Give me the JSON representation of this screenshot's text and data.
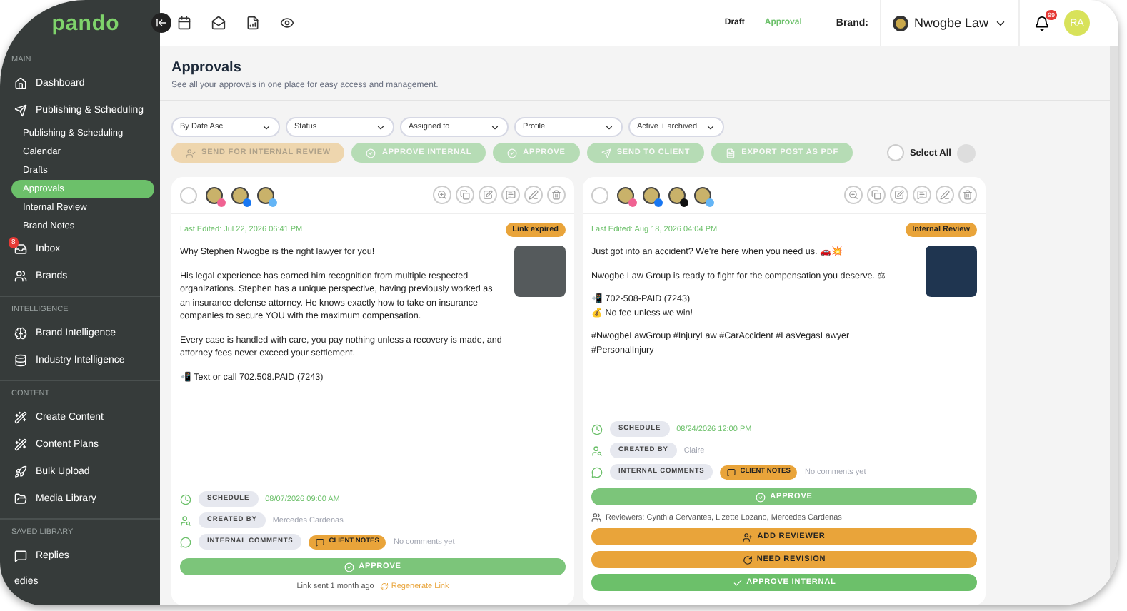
{
  "sidebar": {
    "logo": "pando",
    "sections": [
      {
        "heading": "MAIN",
        "items": [
          {
            "label": "Dashboard",
            "selected": false
          },
          {
            "label": "Publishing & Scheduling",
            "selected": false,
            "children": [
              {
                "label": "Publishing & Scheduling",
                "selected": false
              },
              {
                "label": "Calendar",
                "selected": false
              },
              {
                "label": "Drafts",
                "selected": false
              },
              {
                "label": "Approvals",
                "selected": true
              },
              {
                "label": "Internal Review",
                "selected": false
              },
              {
                "label": "Brand Notes",
                "selected": false
              }
            ]
          },
          {
            "label": "Inbox",
            "selected": false,
            "badge": "8"
          },
          {
            "label": "Brands",
            "selected": false
          }
        ]
      },
      {
        "heading": "INTELLIGENCE",
        "items": [
          {
            "label": "Brand Intelligence",
            "selected": false
          },
          {
            "label": "Industry Intelligence",
            "selected": false
          }
        ]
      },
      {
        "heading": "CONTENT",
        "items": [
          {
            "label": "Create Content",
            "selected": false
          },
          {
            "label": "Content Plans",
            "selected": false
          },
          {
            "label": "Bulk Upload",
            "selected": false
          },
          {
            "label": "Media Library",
            "selected": false
          }
        ]
      },
      {
        "heading": "SAVED LIBRARY",
        "items": [
          {
            "label": "Replies",
            "selected": false
          },
          {
            "label": "edies",
            "selected": false
          }
        ]
      }
    ]
  },
  "topbar": {
    "tabs": [
      {
        "label": "Draft",
        "selected": false
      },
      {
        "label": "Approval",
        "selected": true
      }
    ],
    "brand_label": "Brand:",
    "brand_name": "Nwogbe Law",
    "notifications": "99",
    "avatar": "RA"
  },
  "page": {
    "title": "Approvals",
    "subtitle": "See all your approvals in one place for easy access and management.",
    "filters": [
      {
        "label": "By Date Asc"
      },
      {
        "label": "Status"
      },
      {
        "label": "Assigned to"
      },
      {
        "label": "Profile"
      },
      {
        "label": "Active + archived"
      }
    ],
    "actions": [
      {
        "label": "SEND FOR INTERNAL REVIEW",
        "kind": "review",
        "disabled": true
      },
      {
        "label": "APPROVE INTERNAL",
        "kind": "approve",
        "disabled": true
      },
      {
        "label": "APPROVE",
        "kind": "approve",
        "disabled": true
      },
      {
        "label": "SEND TO CLIENT",
        "kind": "send",
        "disabled": true
      },
      {
        "label": "EXPORT POST AS PDF",
        "kind": "pdf",
        "disabled": true
      }
    ],
    "select_all": {
      "label": "Select All",
      "checked": false
    }
  },
  "cards": [
    {
      "checked": false,
      "platforms": [
        {
          "kind": "instagram"
        },
        {
          "kind": "facebook"
        },
        {
          "kind": "linkedin"
        }
      ],
      "last_edited": "Last Edited: Jul 22, 2026 06:41 PM",
      "status": "Link expired",
      "text": [
        "Why Stephen Nwogbe is the right lawyer for you!",
        "His legal experience has earned him recognition from multiple respected organizations. Stephen has a unique perspective, having previously worked as an insurance defense attorney. He knows exactly how to take on insurance companies to secure YOU with the maximum compensation.",
        "Every case is handled with care, you pay nothing unless a recovery is made, and attorney fees never exceed your settlement.",
        "📲 Text or call 702.508.PAID (7243)"
      ],
      "schedule_label": "SCHEDULE",
      "schedule": "08/07/2026 09:00 AM",
      "created_label": "CREATED BY",
      "created_by": "Mercedes Cardenas",
      "internal_label": "INTERNAL COMMENTS",
      "notes_label": "CLIENT NOTES",
      "comments": "No comments yet",
      "buttons": [
        {
          "label": "APPROVE",
          "kind": "approve"
        }
      ],
      "link_sent": "Link sent 1 month ago",
      "regenerate": "Regenerate Link"
    },
    {
      "checked": false,
      "platforms": [
        {
          "kind": "instagram"
        },
        {
          "kind": "facebook"
        },
        {
          "kind": "x"
        },
        {
          "kind": "linkedin"
        }
      ],
      "last_edited": "Last Edited: Aug 18, 2026 04:04 PM",
      "status": "Internal Review",
      "text": [
        "Just got into an accident? We're here when you need us. 🚗💥",
        "Nwogbe Law Group is ready to fight for the compensation you deserve. ⚖",
        "📲 702-508-PAID (7243)\n💰 No fee unless we win!",
        "#NwogbeLawGroup #InjuryLaw #CarAccident #LasVegasLawyer #PersonalInjury"
      ],
      "schedule_label": "SCHEDULE",
      "schedule": "08/24/2026 12:00 PM",
      "created_label": "CREATED BY",
      "created_by": "Claire",
      "internal_label": "INTERNAL COMMENTS",
      "notes_label": "CLIENT NOTES",
      "comments": "No comments yet",
      "buttons": [
        {
          "label": "APPROVE",
          "kind": "approve"
        },
        {
          "label": "Reviewers: Cynthia Cervantes, Lizette Lozano, Mercedes Cardenas",
          "kind": "reviewers"
        },
        {
          "label": "ADD REVIEWER",
          "kind": "reviewer"
        },
        {
          "label": "NEED REVISION",
          "kind": "revision"
        },
        {
          "label": "APPROVE INTERNAL",
          "kind": "internal"
        }
      ]
    }
  ]
}
